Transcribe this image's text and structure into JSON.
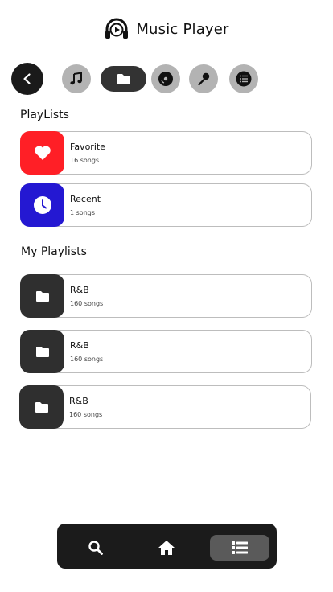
{
  "app": {
    "title": "Music Player"
  },
  "tabs": [
    {
      "icon": "music-note-icon"
    },
    {
      "icon": "folder-icon",
      "active": true
    },
    {
      "icon": "disc-icon"
    },
    {
      "icon": "microphone-icon"
    },
    {
      "icon": "list-icon"
    }
  ],
  "sections": {
    "playlists_title": "PlayLists",
    "my_playlists_title": "My Playlists"
  },
  "playlists": [
    {
      "name": "Favorite",
      "count": "16 songs",
      "icon": "heart-icon",
      "color": "#ff1f26"
    },
    {
      "name": "Recent",
      "count": "1  songs",
      "icon": "clock-icon",
      "color": "#2418d2"
    }
  ],
  "my_playlists": [
    {
      "name": "R&B",
      "count": "160 songs",
      "icon": "folder-icon",
      "color": "#2f2f2f"
    },
    {
      "name": "R&B",
      "count": "160 songs",
      "icon": "folder-icon",
      "color": "#2f2f2f"
    },
    {
      "name": "R&B",
      "count": "160 songs",
      "icon": "folder-icon",
      "color": "#2f2f2f"
    }
  ],
  "bottom_nav": [
    {
      "icon": "search-icon"
    },
    {
      "icon": "home-icon"
    },
    {
      "icon": "list-icon",
      "active": true
    }
  ],
  "colors": {
    "dark": "#1b1b1b",
    "tab_inactive": "#b3b3b3",
    "favorite": "#ff1f26",
    "recent": "#2418d2",
    "folder": "#2f2f2f"
  }
}
